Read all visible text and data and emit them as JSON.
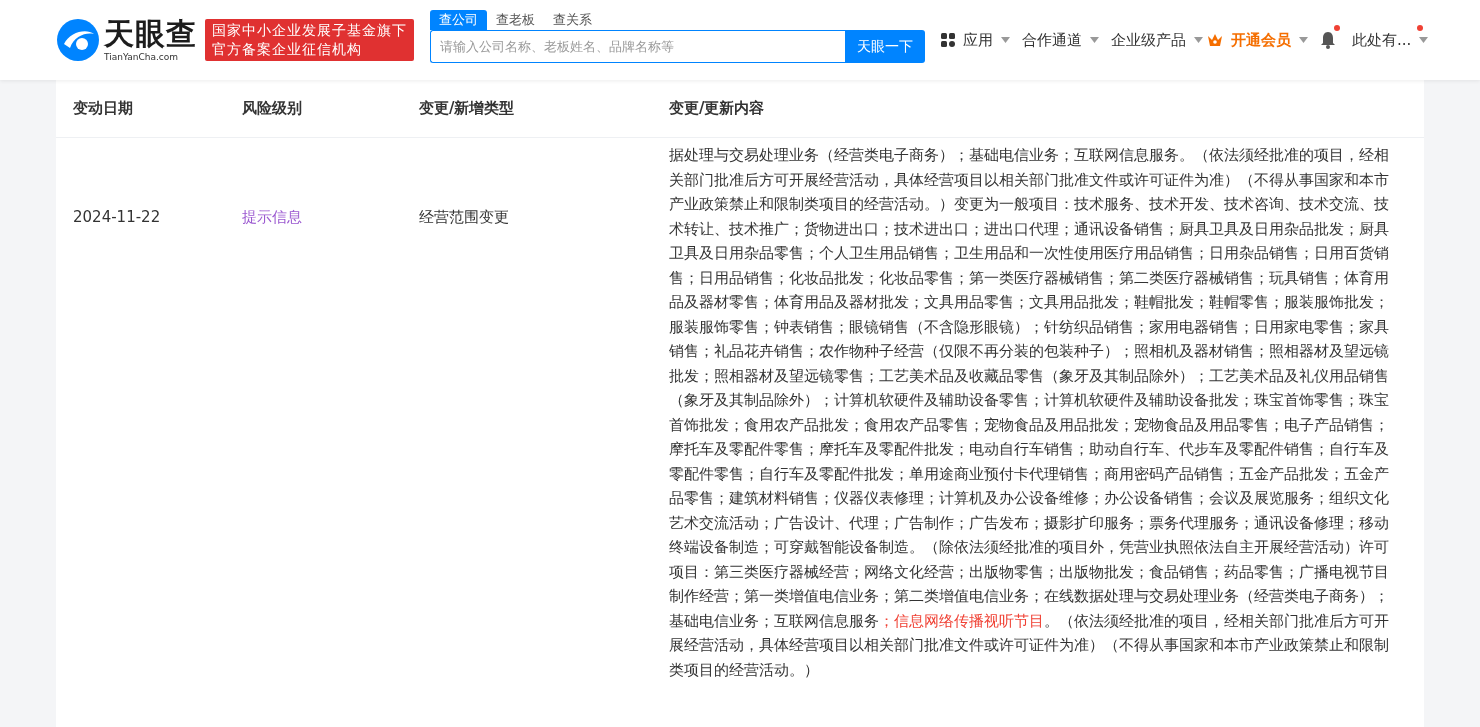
{
  "header": {
    "logo": {
      "name": "天眼查",
      "domain": "TianYanCha.com"
    },
    "badge": [
      "国家中小企业发展子基金旗下",
      "官方备案企业征信机构"
    ],
    "search_tabs": [
      {
        "label": "查公司",
        "selected": true
      },
      {
        "label": "查老板",
        "selected": false
      },
      {
        "label": "查关系",
        "selected": false
      }
    ],
    "search": {
      "placeholder": "请输入公司名称、老板姓名、品牌名称等",
      "button": "天眼一下"
    },
    "nav": [
      {
        "kind": "apps",
        "label": "应用"
      },
      {
        "kind": "plain",
        "label": "合作通道"
      },
      {
        "kind": "plain",
        "label": "企业级产品"
      },
      {
        "kind": "vip",
        "label": "开通会员"
      },
      {
        "kind": "bell"
      },
      {
        "kind": "user",
        "label": "此处有..."
      }
    ]
  },
  "table": {
    "columns": [
      "变动日期",
      "风险级别",
      "变更/新增类型",
      "变更/更新内容"
    ],
    "rows": [
      {
        "date": "2024-11-22",
        "risk": "提示信息",
        "type": "经营范围变更",
        "content": [
          {
            "text": "据处理与交易处理业务（经营类电子商务）；基础电信业务；互联网信息服务。（依法须经批准的项目，经相关部门批准后方可开展经营活动，具体经营项目以相关部门批准文件或许可证件为准）（不得从事国家和本市产业政策禁止和限制类项目的经营活动。）变更为一般项目：技术服务、技术开发、技术咨询、技术交流、技术转让、技术推广；货物进出口；技术进出口；进出口代理；通讯设备销售；厨具卫具及日用杂品批发；厨具卫具及日用杂品零售；个人卫生用品销售；卫生用品和一次性使用医疗用品销售；日用杂品销售；日用百货销售；日用品销售；化妆品批发；化妆品零售；第一类医疗器械销售；第二类医疗器械销售；玩具销售；体育用品及器材零售；体育用品及器材批发；文具用品零售；文具用品批发；鞋帽批发；鞋帽零售；服装服饰批发；服装服饰零售；钟表销售；眼镜销售（不含隐形眼镜）；针纺织品销售；家用电器销售；日用家电零售；家具销售；礼品花卉销售；农作物种子经营（仅限不再分装的包装种子）；照相机及器材销售；照相器材及望远镜批发；照相器材及望远镜零售；工艺美术品及收藏品零售（象牙及其制品除外）；工艺美术品及礼仪用品销售（象牙及其制品除外）；计算机软硬件及辅助设备零售；计算机软硬件及辅助设备批发；珠宝首饰零售；珠宝首饰批发；食用农产品批发；食用农产品零售；宠物食品及用品批发；宠物食品及用品零售；电子产品销售；摩托车及零配件零售；摩托车及零配件批发；电动自行车销售；助动自行车、代步车及零配件销售；自行车及零配件零售；自行车及零配件批发；单用途商业预付卡代理销售；商用密码产品销售；五金产品批发；五金产品零售；建筑材料销售；仪器仪表修理；计算机及办公设备维修；办公设备销售；会议及展览服务；组织文化艺术交流活动；广告设计、代理；广告制作；广告发布；摄影扩印服务；票务代理服务；通讯设备修理；移动终端设备制造；可穿戴智能设备制造。（除依法须经批准的项目外，凭营业执照依法自主开展经营活动）许可项目：第三类医疗器械经营；网络文化经营；出版物零售；出版物批发；食品销售；药品零售；广播电视节目制作经营；第一类增值电信业务；第二类增值电信业务；在线数据处理与交易处理业务（经营类电子商务）；基础电信业务；互联网信息服务",
            "highlight": false
          },
          {
            "text": "；信息网络传播视听节目",
            "highlight": true
          },
          {
            "text": "。（依法须经批准的项目，经相关部门批准后方可开展经营活动，具体经营项目以相关部门批准文件或许可证件为准）（不得从事国家和本市产业政策禁止和限制类项目的经营活动。）",
            "highlight": false
          }
        ]
      }
    ]
  }
}
